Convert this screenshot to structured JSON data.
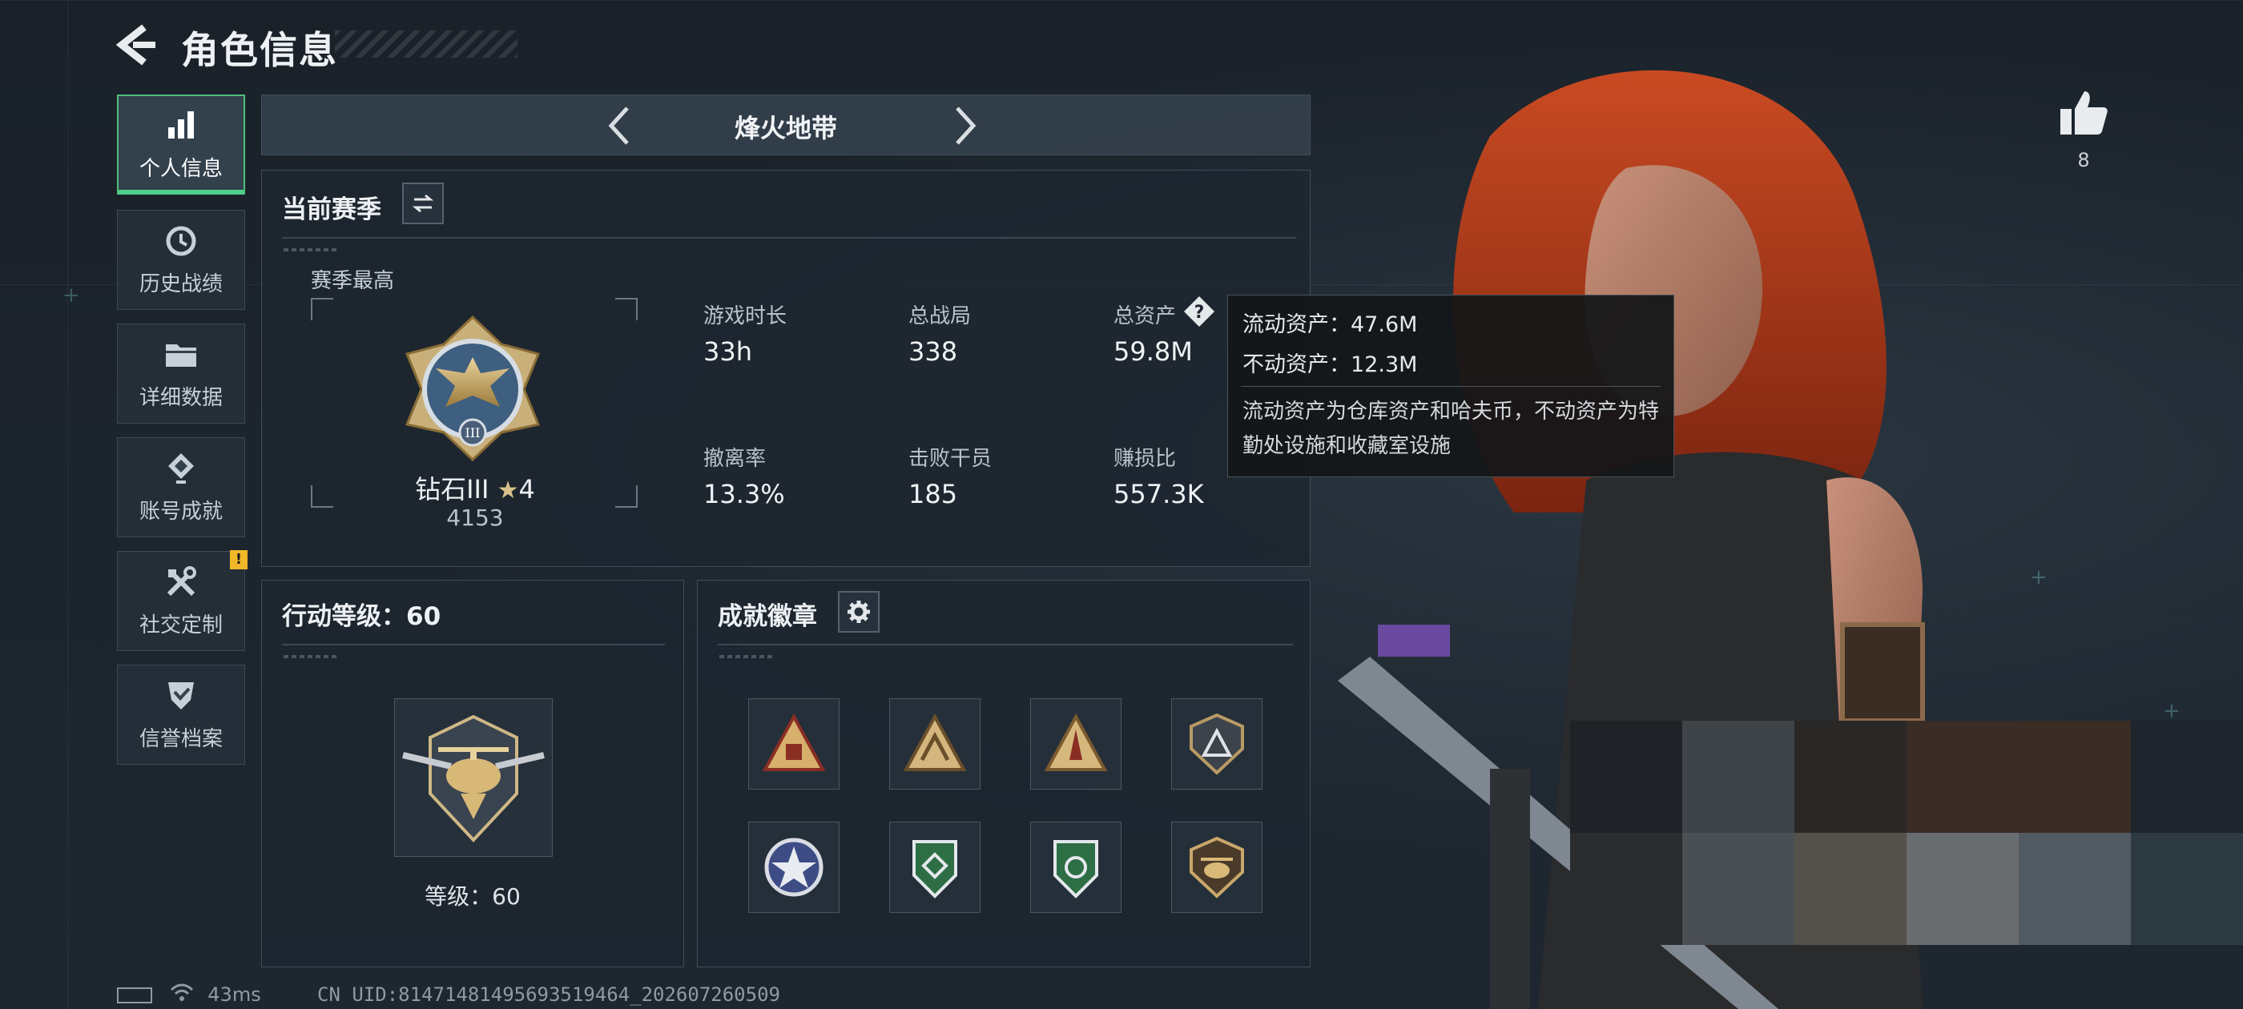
{
  "header": {
    "title": "角色信息"
  },
  "sidebar": {
    "items": [
      {
        "label": "个人信息",
        "icon": "bar-chart-icon",
        "active": true
      },
      {
        "label": "历史战绩",
        "icon": "history-icon"
      },
      {
        "label": "详细数据",
        "icon": "folder-icon"
      },
      {
        "label": "账号成就",
        "icon": "achievement-icon"
      },
      {
        "label": "社交定制",
        "icon": "tools-icon",
        "badge": "!"
      },
      {
        "label": "信誉档案",
        "icon": "shield-check-icon"
      }
    ]
  },
  "mode": {
    "title": "烽火地带"
  },
  "season": {
    "title": "当前赛季",
    "best_label": "赛季最高",
    "rank_name": "钻石III",
    "rank_stars": "4",
    "rank_score": "4153",
    "stats": [
      {
        "label": "游戏时长",
        "value": "33h"
      },
      {
        "label": "总战局",
        "value": "338"
      },
      {
        "label": "总资产",
        "value": "59.8M"
      },
      {
        "label": "撤离率",
        "value": "13.3%"
      },
      {
        "label": "击败干员",
        "value": "185"
      },
      {
        "label": "赚损比",
        "value": "557.3K"
      }
    ]
  },
  "tooltip": {
    "liquid": "流动资产：47.6M",
    "fixed": "不动资产：12.3M",
    "desc": "流动资产为仓库资产和哈夫币，不动资产为特勤处设施和收藏室设施"
  },
  "action_level": {
    "title": "行动等级：60",
    "level_label": "等级：60"
  },
  "achievements": {
    "title": "成就徽章",
    "badges": [
      "triangle-badge-red",
      "triangle-badge-gold",
      "triangle-badge-rocket",
      "shield-badge-dark",
      "star-badge-blue",
      "shield-badge-green",
      "shield-badge-green-2",
      "heli-badge"
    ]
  },
  "like": {
    "count": "8"
  },
  "footer": {
    "ping": "43ms",
    "uid": "CN UID:8147148149569351946​4_202607260509"
  },
  "colors": {
    "accent_green": "#4fd08a",
    "warning_yellow": "#f0b828",
    "hair_red": "#b83a1e"
  }
}
